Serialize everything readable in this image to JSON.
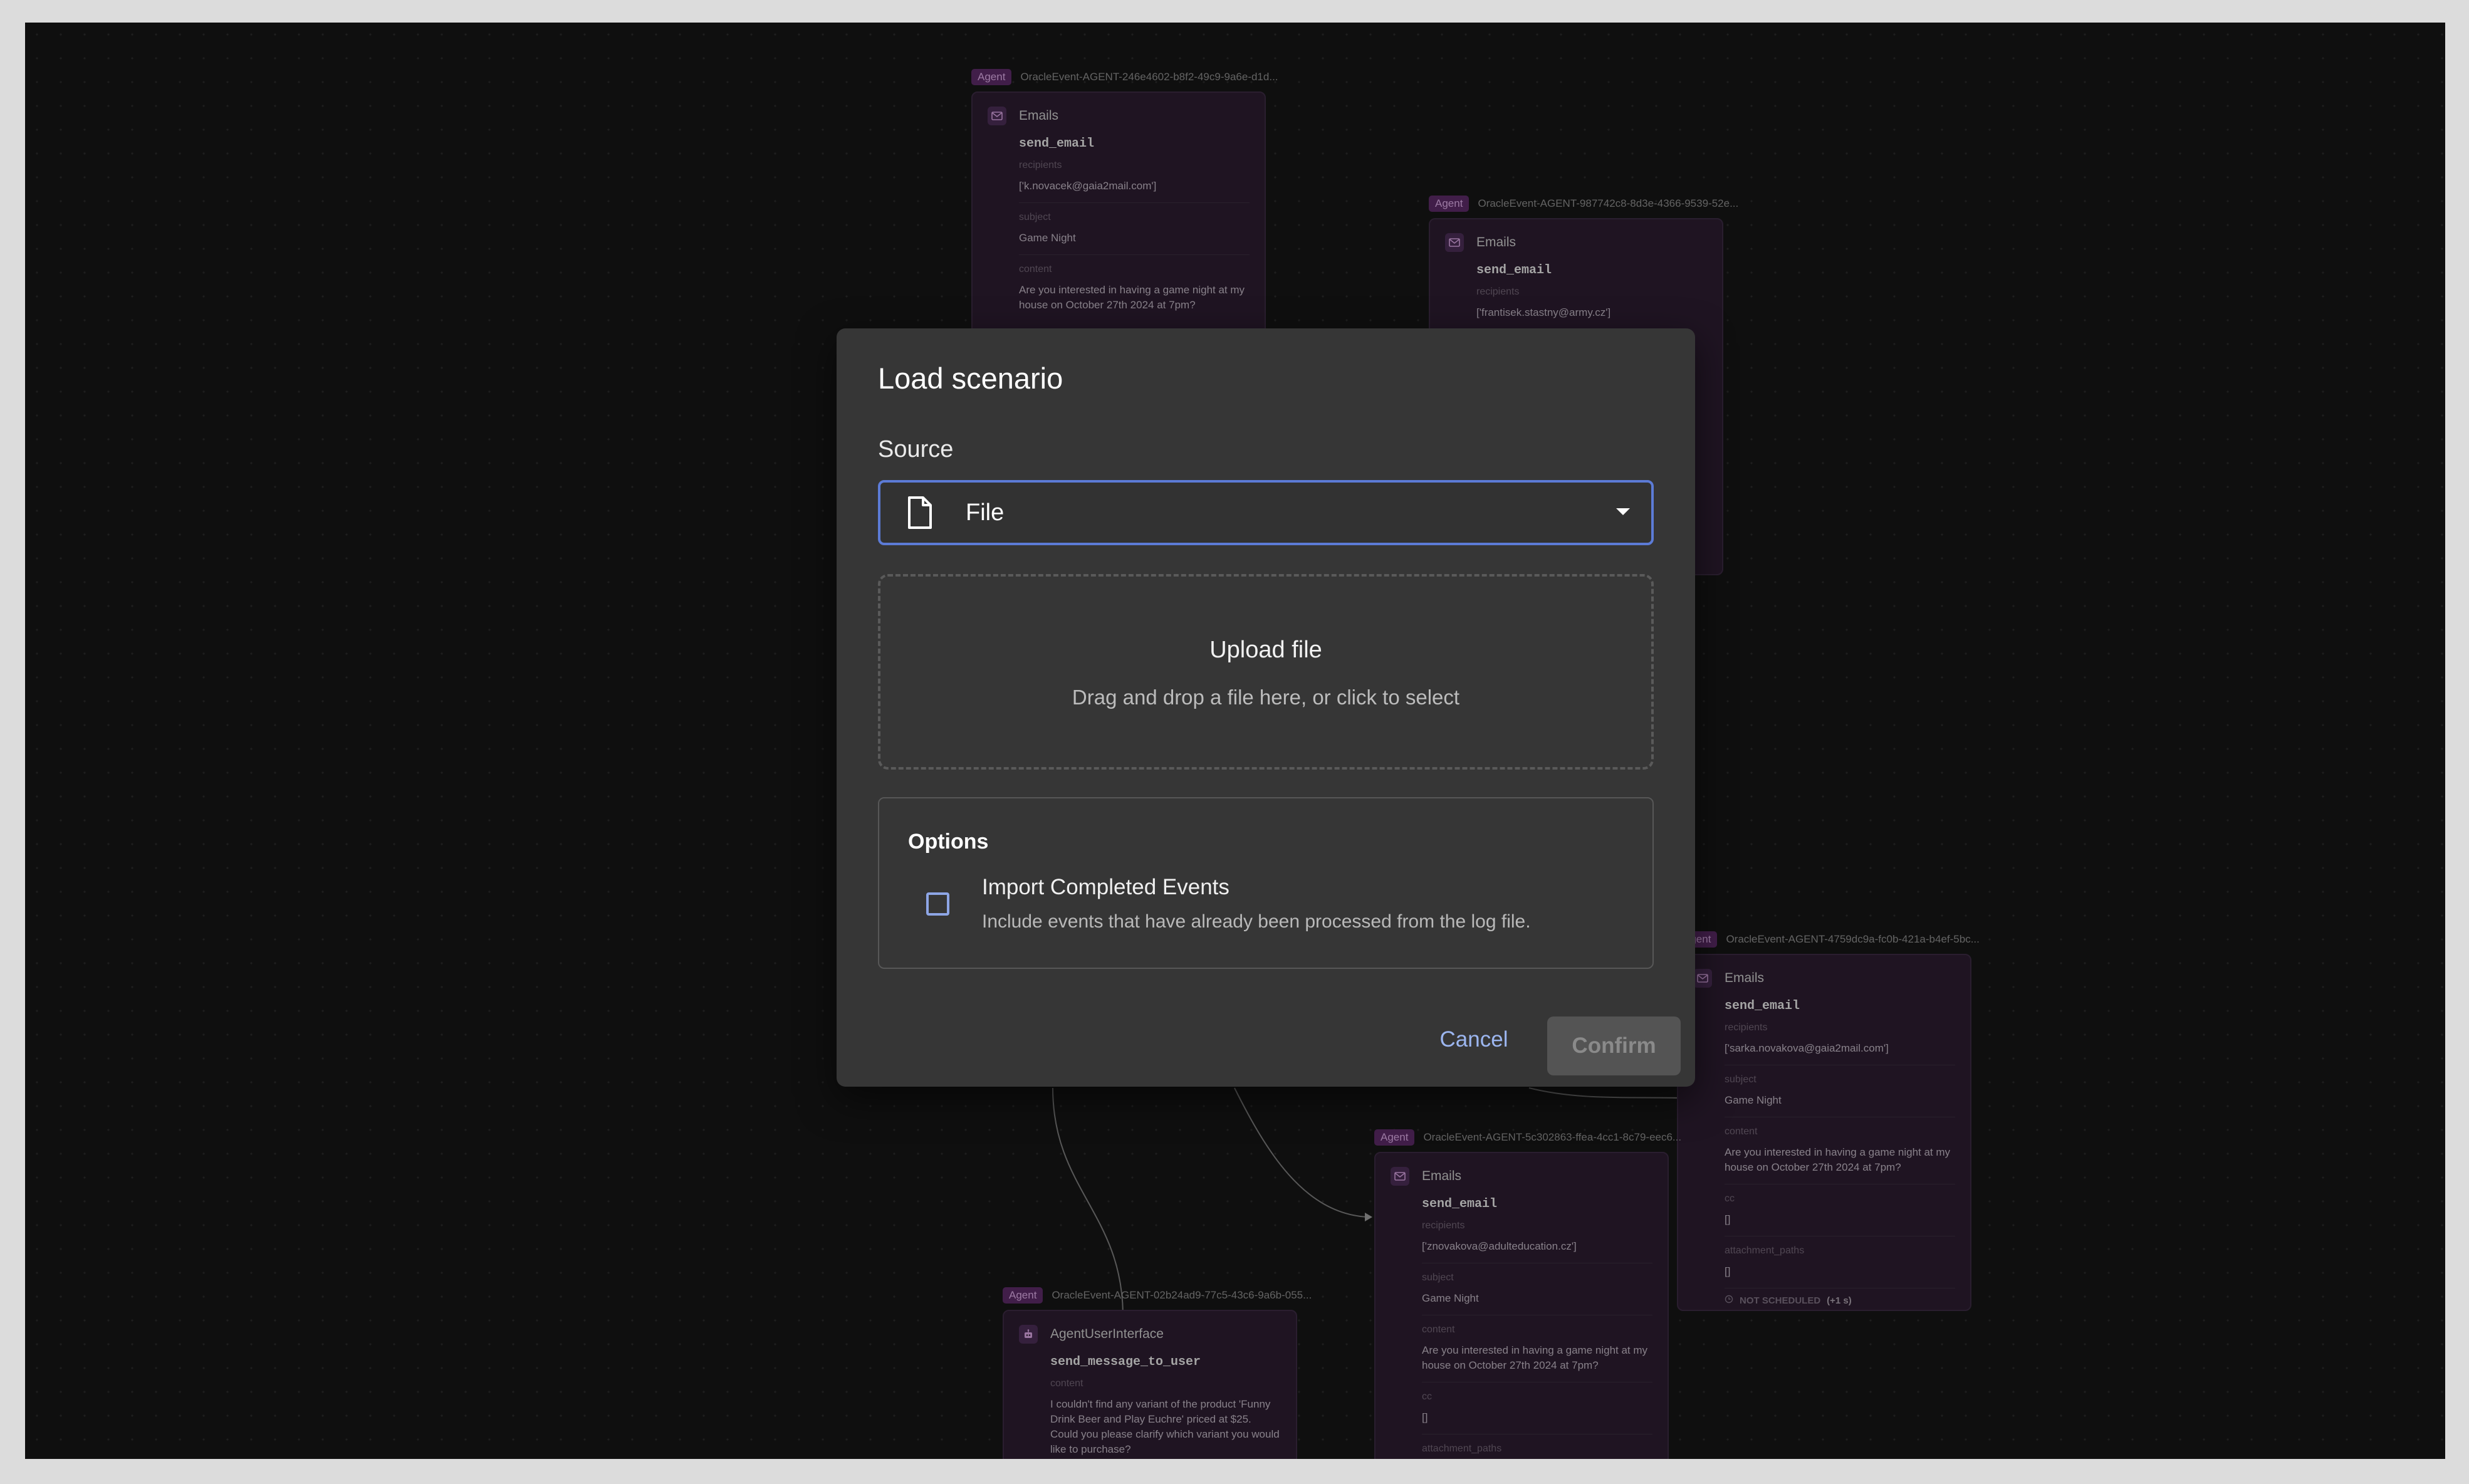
{
  "dialog": {
    "title": "Load scenario",
    "source_label": "Source",
    "source_value": "File",
    "dropzone": {
      "title": "Upload file",
      "subtitle": "Drag and drop a file here, or click to select"
    },
    "options": {
      "title": "Options",
      "import_completed": {
        "label": "Import Completed Events",
        "description": "Include events that have already been processed from the log file.",
        "checked": false
      }
    },
    "cancel_label": "Cancel",
    "confirm_label": "Confirm"
  },
  "nodes": [
    {
      "badge": "Agent",
      "id": "OracleEvent-AGENT-246e4602-b8f2-49c9-9a6e-d1d...",
      "app": "Emails",
      "function": "send_email",
      "fields": [
        {
          "label": "recipients",
          "value": "['k.novacek@gaia2mail.com']"
        },
        {
          "label": "subject",
          "value": "Game Night"
        },
        {
          "label": "content",
          "value": "Are you interested in having a game night at my house on October 27th 2024 at 7pm?"
        }
      ]
    },
    {
      "badge": "Agent",
      "id": "OracleEvent-AGENT-987742c8-8d3e-4366-9539-52e...",
      "app": "Emails",
      "function": "send_email",
      "fields": [
        {
          "label": "recipients",
          "value": "['frantisek.stastny@army.cz']"
        }
      ]
    },
    {
      "badge": "Agent",
      "id": "OracleEvent-AGENT-4759dc9a-fc0b-421a-b4ef-5bc...",
      "app": "Emails",
      "function": "send_email",
      "fields": [
        {
          "label": "recipients",
          "value": "['sarka.novakova@gaia2mail.com']"
        },
        {
          "label": "subject",
          "value": "Game Night"
        },
        {
          "label": "content",
          "value": "Are you interested in having a game night at my house on October 27th 2024 at 7pm?"
        },
        {
          "label": "cc",
          "value": "[]"
        },
        {
          "label": "attachment_paths",
          "value": "[]"
        }
      ],
      "status": "NOT SCHEDULED",
      "status_extra": "(+1 s)"
    },
    {
      "badge": "Agent",
      "id": "OracleEvent-AGENT-5c302863-ffea-4cc1-8c79-eec6...",
      "app": "Emails",
      "function": "send_email",
      "fields": [
        {
          "label": "recipients",
          "value": "['znovakova@adulteducation.cz']"
        },
        {
          "label": "subject",
          "value": "Game Night"
        },
        {
          "label": "content",
          "value": "Are you interested in having a game night at my house on October 27th 2024 at 7pm?"
        },
        {
          "label": "cc",
          "value": "[]"
        },
        {
          "label": "attachment_paths",
          "value": "[]"
        }
      ]
    },
    {
      "badge": "Agent",
      "id": "OracleEvent-AGENT-02b24ad9-77c5-43c6-9a6b-055...",
      "app": "AgentUserInterface",
      "function": "send_message_to_user",
      "fields": [
        {
          "label": "content",
          "value": "I couldn't find any variant of the product 'Funny Drink Beer and Play Euchre' priced at $25. Could you please clarify which variant you would like to purchase?"
        }
      ]
    }
  ],
  "icons": {
    "email": "mail-icon",
    "robot": "robot-icon",
    "file": "file-icon",
    "dropdown": "chevron-down-icon"
  },
  "colors": {
    "accent": "#5c7bd6",
    "agent_badge": "#5a2a66",
    "card_bg": "#2b1d30"
  }
}
